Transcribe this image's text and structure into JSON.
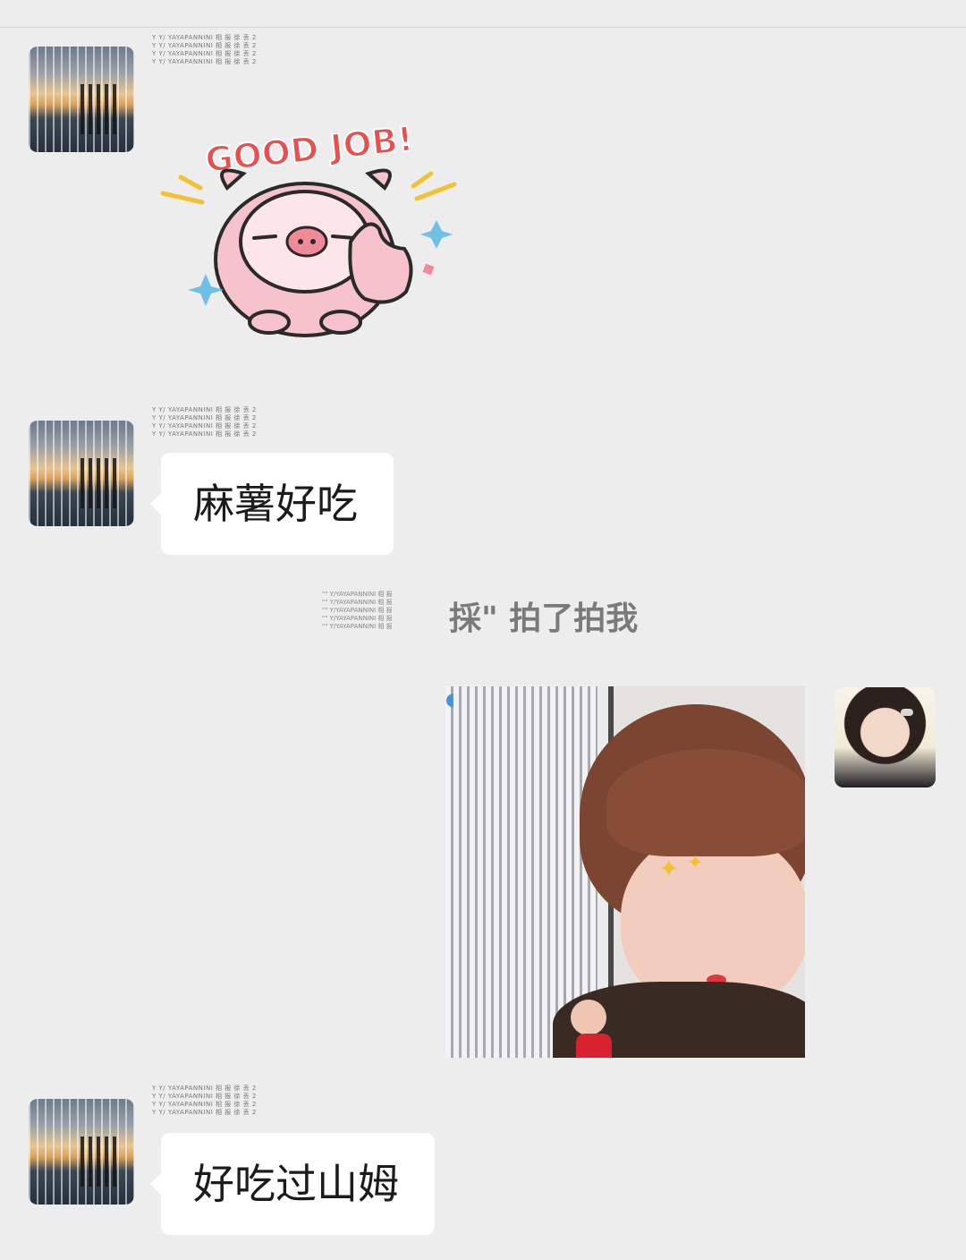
{
  "messages": [
    {
      "id": "msg1",
      "side": "left",
      "nickname": "Y Y/ YAYAPANNINI 相 报 徐 丢 2\nY Y/ YAYAPANNINI 相 报 徐 丢 2\nY Y/ YAYAPANNINI 相 报 徐 丢 2\nY Y/ YAYAPANNINI 相 报 徐 丢 2",
      "type": "sticker",
      "sticker_text": "GOOD JOB!"
    },
    {
      "id": "msg2",
      "side": "left",
      "nickname": "Y Y/ YAYAPANNINI 相 报 徐 丢 2\nY Y/ YAYAPANNINI 相 报 徐 丢 2\nY Y/ YAYAPANNINI 相 报 徐 丢 2\nY Y/ YAYAPANNINI 相 报 徐 丢 2",
      "type": "text",
      "text": "麻薯好吃"
    },
    {
      "id": "msg3",
      "type": "system",
      "nickname": "\"\" Y/YAYAPANNINI 相 报\n\"\" Y/YAYAPANNINI 相 报\n\"\" Y/YAYAPANNINI 相 报\n\"\" Y/YAYAPANNINI 相 报\n\"\" Y/YAYAPANNINI 相 报",
      "text": "採\" 拍了拍我"
    },
    {
      "id": "msg4",
      "side": "right",
      "type": "image",
      "image_desc": ""
    },
    {
      "id": "msg5",
      "side": "left",
      "nickname": "Y Y/ YAYAPANNINI 相 报 徐 丢 2\nY Y/ YAYAPANNINI 相 报 徐 丢 2\nY Y/ YAYAPANNINI 相 报 徐 丢 2\nY Y/ YAYAPANNINI 相 报 徐 丢 2",
      "type": "text",
      "text": "好吃过山姆"
    }
  ],
  "icons": {
    "whale": "whale-icon",
    "sparkle": "sparkle-icon"
  },
  "colors": {
    "background": "#ededed",
    "bubble": "#ffffff",
    "sticker_pink": "#f6c2cb",
    "sticker_text": "#e8504f"
  }
}
